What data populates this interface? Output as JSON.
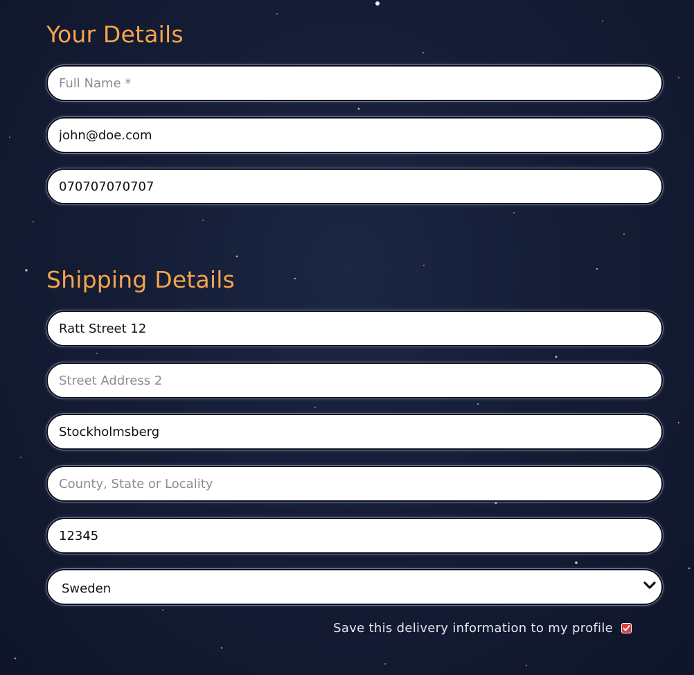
{
  "your_details": {
    "title": "Your Details",
    "full_name": {
      "value": "",
      "placeholder": "Full Name *"
    },
    "email": {
      "value": "john@doe.com",
      "placeholder": ""
    },
    "phone": {
      "value": "070707070707",
      "placeholder": ""
    }
  },
  "shipping_details": {
    "title": "Shipping Details",
    "street_address_1": {
      "value": "Ratt Street 12",
      "placeholder": ""
    },
    "street_address_2": {
      "value": "",
      "placeholder": "Street Address 2"
    },
    "town_or_city": {
      "value": "Stockholmsberg",
      "placeholder": ""
    },
    "county": {
      "value": "",
      "placeholder": "County, State or Locality"
    },
    "postcode": {
      "value": "12345",
      "placeholder": ""
    },
    "country": {
      "selected": "Sweden"
    },
    "save_info": {
      "label": "Save this delivery information to my profile",
      "checked": true
    }
  },
  "colors": {
    "heading": "#f6a44b",
    "background": "#151d36",
    "checkbox_accent": "#e23b3b"
  },
  "icons": {
    "select_arrow": "chevron-down-icon",
    "checkbox_mark": "checkmark-icon"
  }
}
